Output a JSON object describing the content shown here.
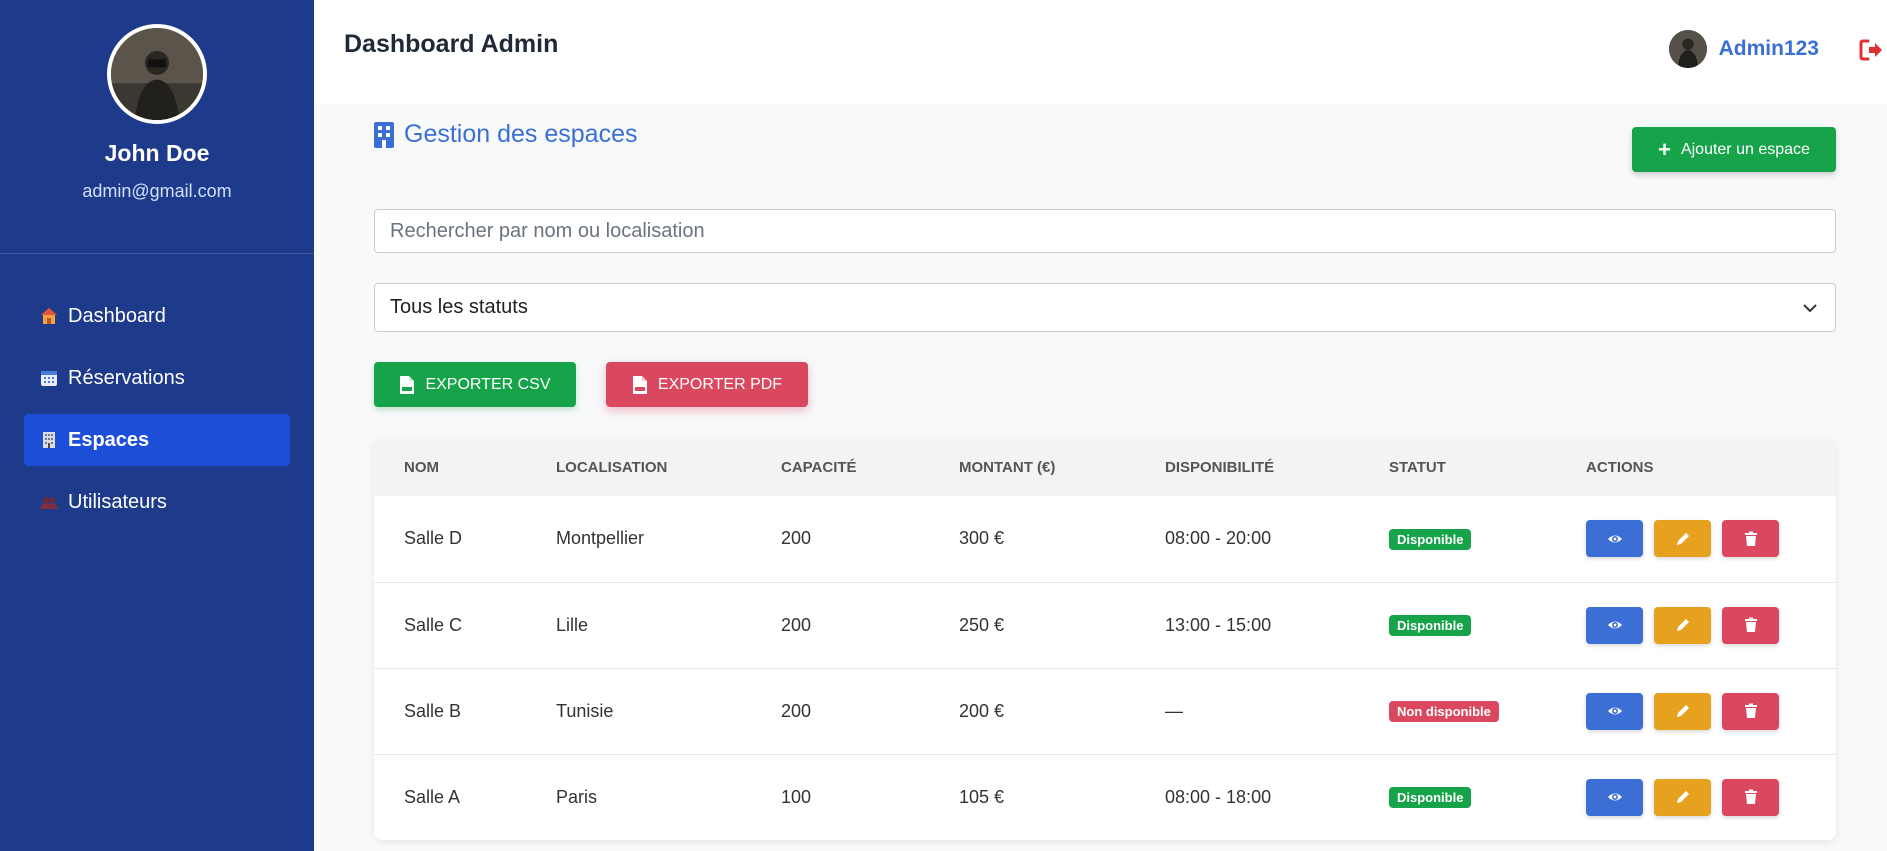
{
  "sidebar": {
    "profile": {
      "name": "John Doe",
      "email": "admin@gmail.com"
    },
    "items": [
      {
        "label": "Dashboard",
        "icon": "house-icon",
        "active": false
      },
      {
        "label": "Réservations",
        "icon": "calendar-icon",
        "active": false
      },
      {
        "label": "Espaces",
        "icon": "office-building-icon",
        "active": true
      },
      {
        "label": "Utilisateurs",
        "icon": "users-icon",
        "active": false
      }
    ]
  },
  "header": {
    "title": "Dashboard Admin",
    "username": "Admin123",
    "logout_icon": "sign-out-icon"
  },
  "main": {
    "title": "Gestion des espaces",
    "add_button": "Ajouter un espace",
    "search": {
      "placeholder": "Rechercher par nom ou localisation",
      "value": ""
    },
    "status_filter": {
      "selected": "Tous les statuts"
    },
    "export_csv": "EXPORTER CSV",
    "export_pdf": "EXPORTER PDF",
    "table": {
      "headers": [
        "NOM",
        "LOCALISATION",
        "CAPACITÉ",
        "MONTANT (€)",
        "DISPONIBILITÉ",
        "STATUT",
        "ACTIONS"
      ],
      "rows": [
        {
          "nom": "Salle D",
          "localisation": "Montpellier",
          "capacite": "200",
          "montant": "300 €",
          "disponibilite": "08:00 - 20:00",
          "statut": "Disponible",
          "available": true
        },
        {
          "nom": "Salle C",
          "localisation": "Lille",
          "capacite": "200",
          "montant": "250 €",
          "disponibilite": "13:00 - 15:00",
          "statut": "Disponible",
          "available": true
        },
        {
          "nom": "Salle B",
          "localisation": "Tunisie",
          "capacite": "200",
          "montant": "200 €",
          "disponibilite": "—",
          "statut": "Non disponible",
          "available": false
        },
        {
          "nom": "Salle A",
          "localisation": "Paris",
          "capacite": "100",
          "montant": "105 €",
          "disponibilite": "08:00 - 18:00",
          "statut": "Disponible",
          "available": true
        }
      ]
    }
  },
  "colors": {
    "sidebar": "#1e3a8a",
    "active": "#1d4ed8",
    "accent": "#3b6fd6",
    "success": "#16a34a",
    "danger": "#d9485f",
    "warning": "#e6a11f"
  }
}
